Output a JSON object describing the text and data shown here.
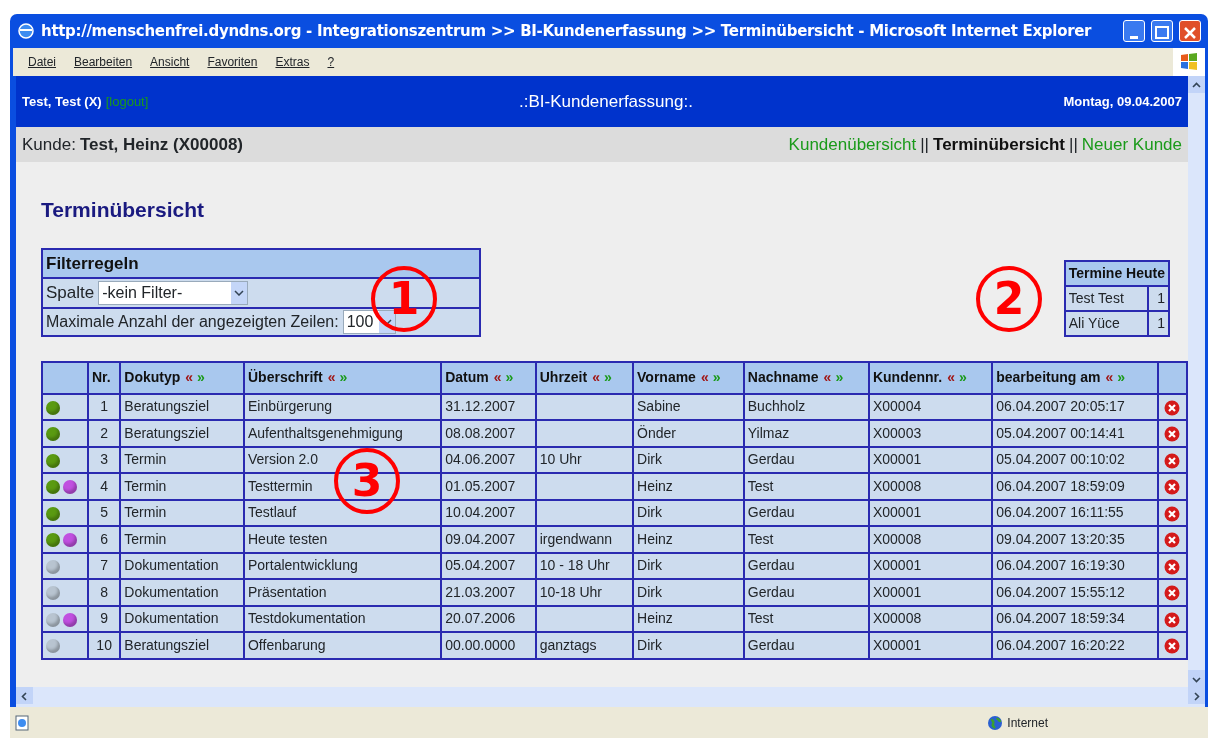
{
  "window": {
    "title": "http://menschenfrei.dyndns.org - Integrationszentrum >> BI-Kundenerfassung >> Terminübersicht - Microsoft Internet Explorer"
  },
  "menu": [
    "Datei",
    "Bearbeiten",
    "Ansicht",
    "Favoriten",
    "Extras",
    "?"
  ],
  "header": {
    "user": "Test, Test (X)",
    "logout": "[logout]",
    "app_title": ".:BI-Kundenerfassung:.",
    "date": "Montag, 09.04.2007"
  },
  "nav": {
    "customer_label": "Kunde:",
    "customer": "Test, Heinz (X00008)",
    "links": [
      {
        "label": "Kundenübersicht",
        "selected": false
      },
      {
        "label": "Terminübersicht",
        "selected": true
      },
      {
        "label": "Neuer Kunde",
        "selected": false
      }
    ],
    "separator": "||"
  },
  "page_title": "Terminübersicht",
  "filter": {
    "title": "Filterregeln",
    "column_label": "Spalte",
    "column_value": "-kein Filter-",
    "rows_label": "Maximale Anzahl der angezeigten Zeilen:",
    "rows_value": "100"
  },
  "today": {
    "title": "Termine Heute",
    "rows": [
      {
        "name": "Test Test",
        "count": "1"
      },
      {
        "name": "Ali Yüce",
        "count": "1"
      }
    ]
  },
  "table": {
    "columns": [
      {
        "label": "Nr."
      },
      {
        "label": "Dokutyp",
        "sort_asc": "«",
        "sort_desc": "»"
      },
      {
        "label": "Überschrift",
        "sort_asc": "«",
        "sort_desc": "»"
      },
      {
        "label": "Datum",
        "sort_asc": "«",
        "sort_desc": "»"
      },
      {
        "label": "Uhrzeit",
        "sort_asc": "«",
        "sort_desc": "»"
      },
      {
        "label": "Vorname",
        "sort_asc": "«",
        "sort_desc": "»"
      },
      {
        "label": "Nachname",
        "sort_asc": "«",
        "sort_desc": "»"
      },
      {
        "label": "Kundennr.",
        "sort_asc": "«",
        "sort_desc": "»"
      },
      {
        "label": "bearbeitung am",
        "sort_asc": "«",
        "sort_desc": "»"
      }
    ],
    "rows": [
      {
        "color": "#5a9a12",
        "today": false,
        "cells": [
          "1",
          "Beratungsziel",
          "Einbürgerung",
          "31.12.2007",
          "",
          "Sabine",
          "Buchholz",
          "X00004",
          "06.04.2007 20:05:17"
        ]
      },
      {
        "color": "#5a9a12",
        "today": false,
        "cells": [
          "2",
          "Beratungsziel",
          "Aufenthaltsgenehmigung",
          "08.08.2007",
          "",
          "Önder",
          "Yilmaz",
          "X00003",
          "05.04.2007 00:14:41"
        ]
      },
      {
        "color": "#5a9a12",
        "today": false,
        "cells": [
          "3",
          "Termin",
          "Version 2.0",
          "04.06.2007",
          "10 Uhr",
          "Dirk",
          "Gerdau",
          "X00001",
          "05.04.2007 00:10:02"
        ]
      },
      {
        "color": "#5a9a12",
        "today": true,
        "cells": [
          "4",
          "Termin",
          "Testtermin",
          "01.05.2007",
          "",
          "Heinz",
          "Test",
          "X00008",
          "06.04.2007 18:59:09"
        ]
      },
      {
        "color": "#5a9a12",
        "today": false,
        "cells": [
          "5",
          "Termin",
          "Testlauf",
          "10.04.2007",
          "",
          "Dirk",
          "Gerdau",
          "X00001",
          "06.04.2007 16:11:55"
        ]
      },
      {
        "color": "#5a9a12",
        "today": true,
        "cells": [
          "6",
          "Termin",
          "Heute testen",
          "09.04.2007",
          "irgendwann",
          "Heinz",
          "Test",
          "X00008",
          "09.04.2007 13:20:35"
        ]
      },
      {
        "color": "#b8c4d0",
        "today": false,
        "cells": [
          "7",
          "Dokumentation",
          "Portalentwicklung",
          "05.04.2007",
          "10 - 18 Uhr",
          "Dirk",
          "Gerdau",
          "X00001",
          "06.04.2007 16:19:30"
        ]
      },
      {
        "color": "#b8c4d0",
        "today": false,
        "cells": [
          "8",
          "Dokumentation",
          "Präsentation",
          "21.03.2007",
          "10-18 Uhr",
          "Dirk",
          "Gerdau",
          "X00001",
          "06.04.2007 15:55:12"
        ]
      },
      {
        "color": "#b8c4d0",
        "today": true,
        "cells": [
          "9",
          "Dokumentation",
          "Testdokumentation",
          "20.07.2006",
          "",
          "Heinz",
          "Test",
          "X00008",
          "06.04.2007 18:59:34"
        ]
      },
      {
        "color": "#b8c4d0",
        "today": false,
        "cells": [
          "10",
          "Beratungsziel",
          "Offenbarung",
          "00.00.0000",
          "ganztags",
          "Dirk",
          "Gerdau",
          "X00001",
          "06.04.2007 16:20:22"
        ]
      }
    ]
  },
  "callouts": [
    "1",
    "2",
    "3"
  ],
  "status_bar": {
    "zone": "Internet"
  }
}
